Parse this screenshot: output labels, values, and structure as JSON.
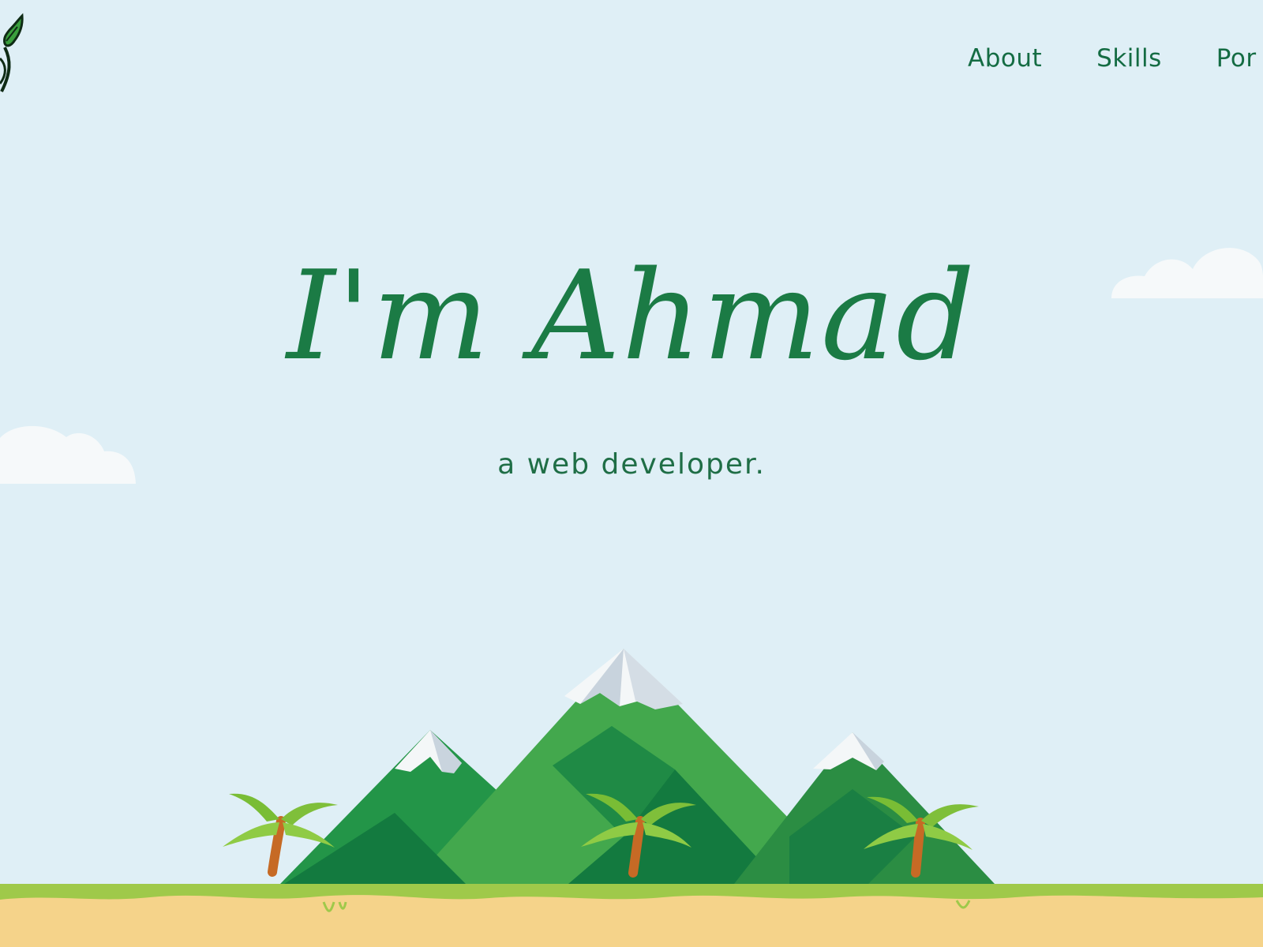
{
  "nav": {
    "items": [
      {
        "label": "About"
      },
      {
        "label": "Skills"
      },
      {
        "label": "Por"
      }
    ]
  },
  "hero": {
    "title": "I'm Ahmad",
    "subtitle": "a web developer."
  },
  "icons": {
    "logo": "leaf-logo-icon",
    "cloud": "cloud-icon",
    "mountain": "mountain-icon",
    "palm": "palm-tree-icon"
  },
  "colors": {
    "sky": "#dfeff6",
    "text_green": "#146c43",
    "heading_green": "#1b7b45",
    "mountain_green": "#43a84d",
    "dark_mountain_green": "#137a3f",
    "snow": "#eef3f6",
    "grass": "#9fc94a",
    "sand": "#f5d38a",
    "trunk": "#c66a25",
    "cloud": "#f6f9fa"
  }
}
